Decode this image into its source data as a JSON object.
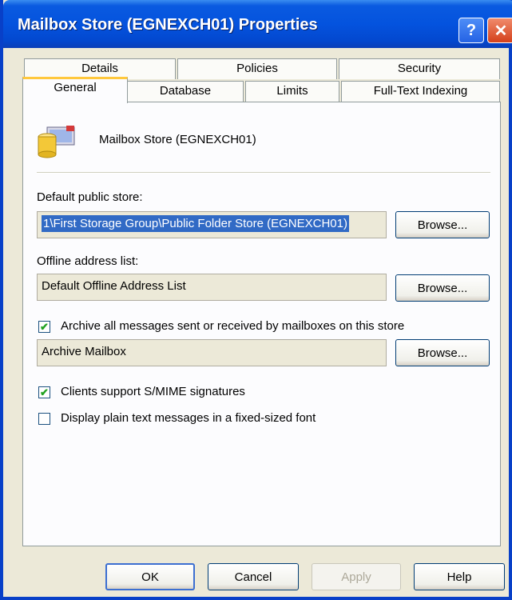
{
  "window": {
    "title": "Mailbox Store (EGNEXCH01) Properties",
    "help_glyph": "?",
    "close_glyph": "✕"
  },
  "tabs": {
    "row1": [
      "Details",
      "Policies",
      "Security"
    ],
    "row2": [
      "General",
      "Database",
      "Limits",
      "Full-Text Indexing"
    ],
    "active": "General"
  },
  "general": {
    "store_name": "Mailbox Store (EGNEXCH01)",
    "default_public_store_label": "Default public store:",
    "default_public_store_value": "1\\First Storage Group\\Public Folder Store (EGNEXCH01)",
    "offline_address_list_label": "Offline address list:",
    "offline_address_list_value": "Default Offline Address List",
    "archive_checkbox_label": "Archive all messages sent or received by mailboxes on this store",
    "archive_checked": true,
    "archive_value": "Archive Mailbox",
    "browse_label": "Browse...",
    "smime_label": "Clients support S/MIME signatures",
    "smime_checked": true,
    "plain_text_label": "Display plain text messages in a fixed-sized font",
    "plain_text_checked": false
  },
  "buttons": {
    "ok": "OK",
    "cancel": "Cancel",
    "apply": "Apply",
    "help": "Help"
  },
  "icons": {
    "store": "mailbox-store-icon",
    "check": "✔"
  }
}
